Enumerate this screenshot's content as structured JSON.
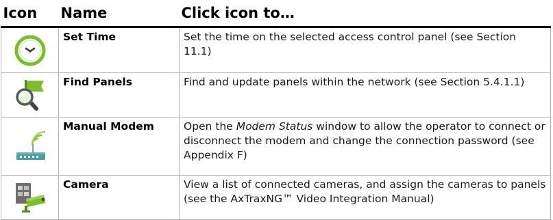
{
  "table": {
    "headers": {
      "icon": "Icon",
      "name": "Name",
      "action": "Click icon to…"
    },
    "rows": [
      {
        "icon": "clock-icon",
        "name": "Set Time",
        "description": "Set the time on the selected access control panel (see Section 11.1)"
      },
      {
        "icon": "magnifier-flag-icon",
        "name": "Find Panels",
        "description": "Find and update panels within the network (see Section 5.4.1.1)"
      },
      {
        "icon": "modem-icon",
        "name": "Manual Modem",
        "description_before": "Open the ",
        "description_emphasis": "Modem Status",
        "description_after": " window to allow the operator to connect or disconnect the modem and change the connection password (see Appendix F)"
      },
      {
        "icon": "camera-icon",
        "name": "Camera",
        "description": "View a list of connected cameras, and assign the cameras to panels (see the AxTraxNG™ Video Integration Manual)"
      }
    ]
  },
  "colors": {
    "icon_green": "#7cbc2e",
    "icon_dark_green": "#4e8f1c",
    "border": "#b4b4b4",
    "header_rule": "#000000"
  }
}
